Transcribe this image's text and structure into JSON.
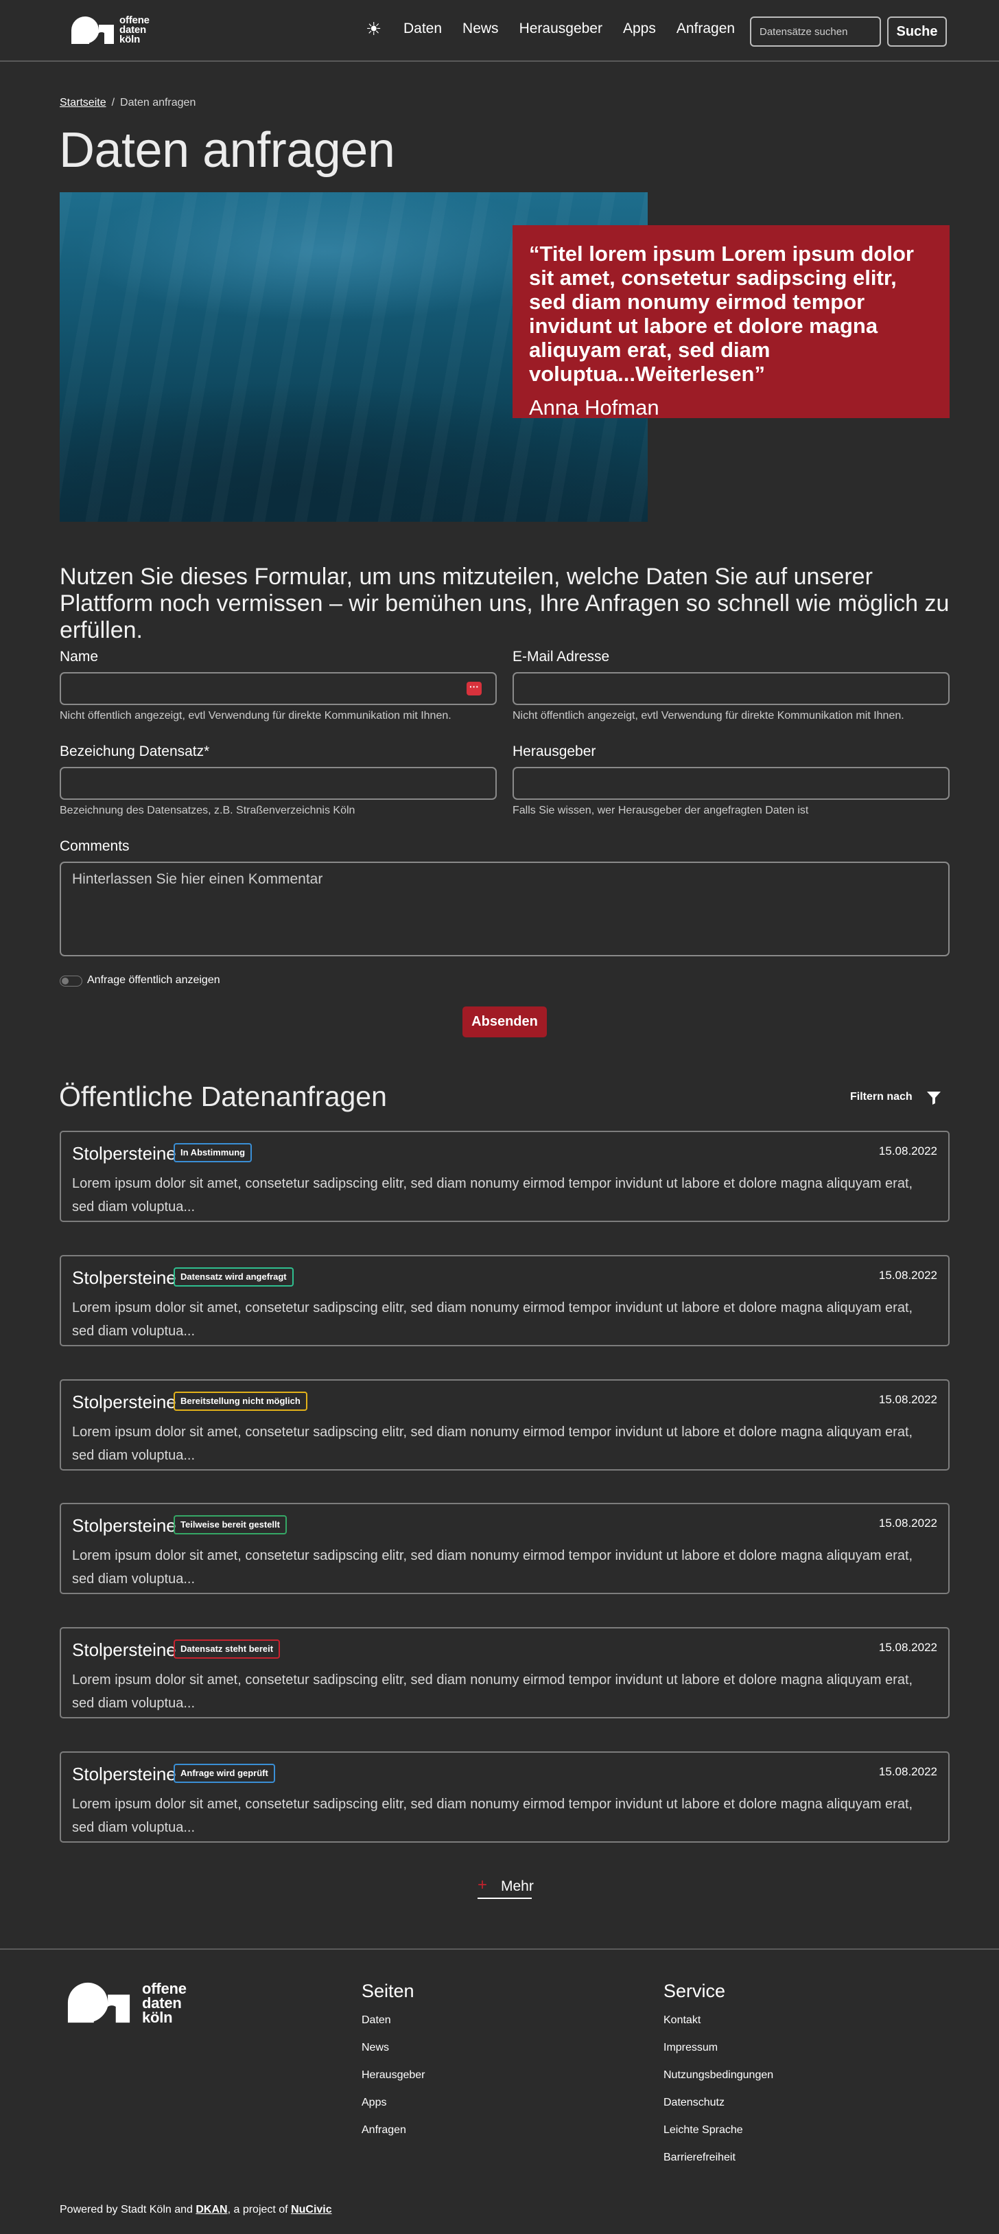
{
  "header": {
    "logo_text": [
      "offene",
      "daten",
      "köln"
    ],
    "theme_toggle_icon": "sun-icon",
    "nav": [
      "Daten",
      "News",
      "Herausgeber",
      "Apps",
      "Anfragen"
    ],
    "search_placeholder": "Datensätze suchen",
    "search_button": "Suche"
  },
  "breadcrumb": {
    "home": "Startseite",
    "separator": "/",
    "current": "Daten anfragen"
  },
  "page_title": "Daten anfragen",
  "hero": {
    "quote": "“Titel lorem ipsum Lorem ipsum dolor sit amet, consetetur sadipscing elitr, sed diam nonumy eirmod tempor invidunt ut labore et dolore magna aliquyam erat, sed diam voluptua...Weiterlesen”",
    "author": "Anna Hofman",
    "quote_bg": "#9c1c26"
  },
  "intro": "Nutzen Sie dieses Formular, um uns mitzuteilen, welche Daten Sie auf unserer Plattform noch vermissen – wir bemühen uns, Ihre Anfragen so schnell wie möglich zu erfüllen.",
  "form": {
    "name_label": "Name",
    "name_help": "Nicht öffentlich angezeigt, evtl Verwendung für direkte Kommunikation mit Ihnen.",
    "email_label": "E-Mail Adresse",
    "email_help": "Nicht öffentlich angezeigt, evtl Verwendung für direkte Kommunikation mit Ihnen.",
    "dataset_label": "Bezeichung Datensatz*",
    "dataset_help": "Bezeichnung des Datensatzes, z.B. Straßenverzeichnis Köln",
    "publisher_label": "Herausgeber",
    "publisher_help": "Falls Sie wissen, wer Herausgeber der angefragten Daten ist",
    "comments_label": "Comments",
    "comments_placeholder": "Hinterlassen Sie hier einen Kommentar",
    "public_toggle_label": "Anfrage öffentlich anzeigen",
    "submit": "Absenden"
  },
  "requests": {
    "title": "Öffentliche Datenanfragen",
    "filter_label": "Filtern nach",
    "items": [
      {
        "title": "Stolpersteine",
        "status": "In Abstimmung",
        "status_color": "#3a8fd6",
        "date": "15.08.2022",
        "text": "Lorem ipsum dolor sit amet, consetetur sadipscing elitr, sed diam nonumy eirmod tempor invidunt ut labore et dolore magna aliquyam erat, sed diam voluptua..."
      },
      {
        "title": "Stolpersteine",
        "status": "Datensatz wird angefragt",
        "status_color": "#2fbf8f",
        "date": "15.08.2022",
        "text": "Lorem ipsum dolor sit amet, consetetur sadipscing elitr, sed diam nonumy eirmod tempor invidunt ut labore et dolore magna aliquyam erat, sed diam voluptua..."
      },
      {
        "title": "Stolpersteine",
        "status": "Bereitstellung nicht möglich",
        "status_color": "#e3b21a",
        "date": "15.08.2022",
        "text": "Lorem ipsum dolor sit amet, consetetur sadipscing elitr, sed diam nonumy eirmod tempor invidunt ut labore et dolore magna aliquyam erat, sed diam voluptua..."
      },
      {
        "title": "Stolpersteine",
        "status": "Teilweise bereit gestellt",
        "status_color": "#35a866",
        "date": "15.08.2022",
        "text": "Lorem ipsum dolor sit amet, consetetur sadipscing elitr, sed diam nonumy eirmod tempor invidunt ut labore et dolore magna aliquyam erat, sed diam voluptua..."
      },
      {
        "title": "Stolpersteine",
        "status": "Datensatz steht bereit",
        "status_color": "#c8232f",
        "date": "15.08.2022",
        "text": "Lorem ipsum dolor sit amet, consetetur sadipscing elitr, sed diam nonumy eirmod tempor invidunt ut labore et dolore magna aliquyam erat, sed diam voluptua..."
      },
      {
        "title": "Stolpersteine",
        "status": "Anfrage wird geprüft",
        "status_color": "#3a8fd6",
        "date": "15.08.2022",
        "text": "Lorem ipsum dolor sit amet, consetetur sadipscing elitr, sed diam nonumy eirmod tempor invidunt ut labore et dolore magna aliquyam erat, sed diam voluptua..."
      }
    ],
    "more_label": "Mehr"
  },
  "footer": {
    "logo_text": [
      "offene",
      "daten",
      "köln"
    ],
    "pages_title": "Seiten",
    "pages": [
      "Daten",
      "News",
      "Herausgeber",
      "Apps",
      "Anfragen"
    ],
    "service_title": "Service",
    "service": [
      "Kontakt",
      "Impressum",
      "Nutzungsbedingungen",
      "Datenschutz",
      "Leichte Sprache",
      "Barrierefreiheit"
    ],
    "powered_prefix": "Powered by Stadt Köln and ",
    "powered_dkan": "DKAN",
    "powered_middle": ", a project of ",
    "powered_nucivic": "NuCivic"
  }
}
